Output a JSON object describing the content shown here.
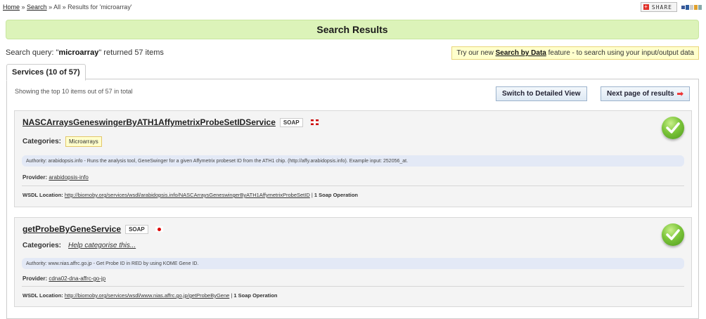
{
  "breadcrumb": {
    "home": "Home",
    "sep1": " » ",
    "search": "Search",
    "rest": " » All » Results for 'microarray'"
  },
  "share": {
    "label": "SHARE",
    "plus": "+"
  },
  "banner": {
    "title": "Search Results"
  },
  "query": {
    "prefix": "Search query: \"",
    "term": "microarray",
    "suffix": "\" returned 57 items"
  },
  "try_box": {
    "prefix": "Try our new ",
    "link": "Search by Data",
    "suffix": " feature - to search using your input/output data"
  },
  "tab": {
    "label": "Services (10 of 57)"
  },
  "panel": {
    "showing": "Showing the top 10 items out of 57 in total",
    "detailed_view_label": "Switch to Detailed View",
    "next_page_label": "Next page of results",
    "next_arrow": "➡"
  },
  "services": [
    {
      "name": "NASCArraysGeneswingerByATH1AffymetrixProbeSetIDService",
      "type": "SOAP",
      "categories_label": "Categories:",
      "category": "Microarrays",
      "description": "Authority: arabidopsis.info - Runs the analysis tool, GeneSwinger for a given Affymetrix probeset ID from the ATH1 chip. (http://affy.arabidopsis.info). Example input: 252056_at.",
      "provider_label": "Provider:",
      "provider": "arabidopsis-info",
      "wsdl_label": "WSDL Location:",
      "wsdl_url": "http://biomoby.org/services/wsdl/arabidopsis.info/NASCArraysGeneswingerByATH1AffymetrixProbeSetID",
      "wsdl_sep": " | ",
      "operations": "1 Soap Operation"
    },
    {
      "name": "getProbeByGeneService",
      "type": "SOAP",
      "categories_label": "Categories:",
      "category_help": "Help categorise this...",
      "description": "Authority: www.nias.affrc.go.jp - Get Probe ID in RED by using KOME Gene ID.",
      "provider_label": "Provider:",
      "provider": "cdna02-dna-affrc-go-jp",
      "wsdl_label": "WSDL Location:",
      "wsdl_url": "http://biomoby.org/services/wsdl/www.nias.affrc.go.jp/getProbeByGene",
      "wsdl_sep": " | ",
      "operations": "1 Soap Operation"
    }
  ],
  "icons": {
    "check": "check-circle-icon",
    "flag_uk": "uk-flag-icon",
    "flag_jp": "japan-flag-icon",
    "share_plus": "plus-icon",
    "next_arrow": "right-arrow-icon"
  },
  "colors": {
    "banner_bg": "#dcf3b9",
    "try_bg": "#ffffcc",
    "desc_bg": "#e3e9f6",
    "check_green": "#7cc53a",
    "arrow_red": "#e33333"
  }
}
